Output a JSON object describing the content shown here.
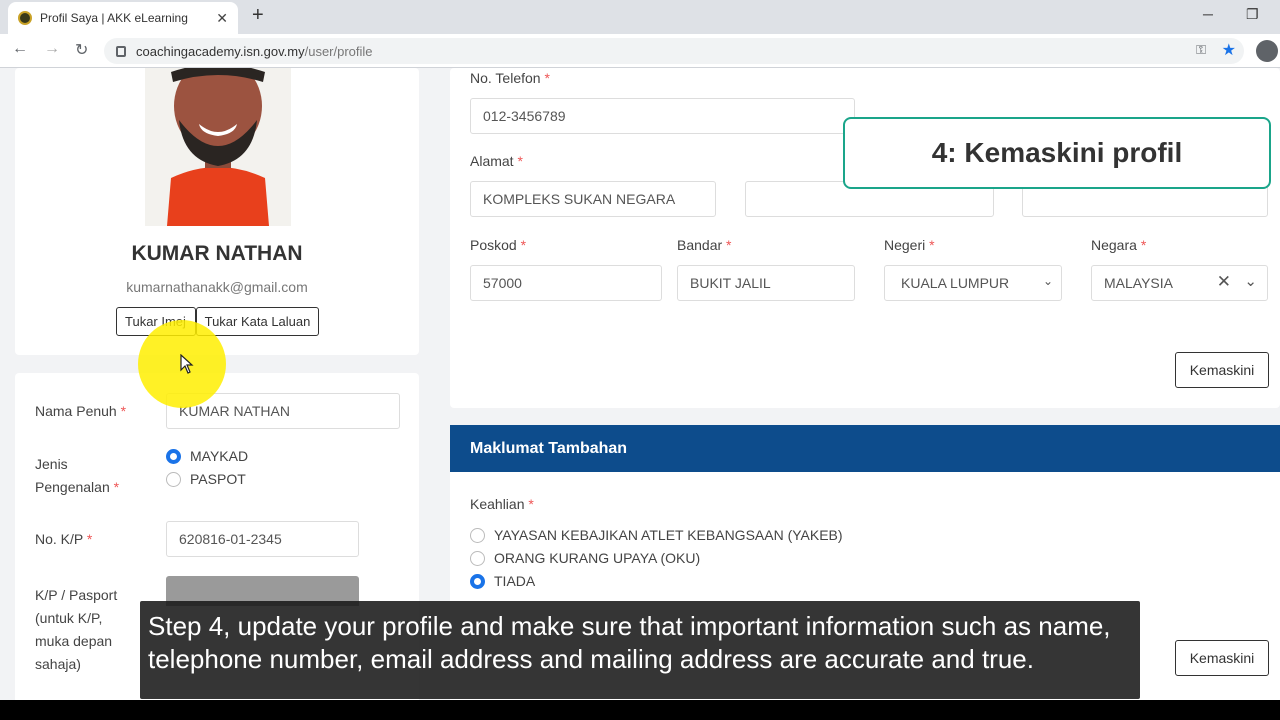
{
  "browser": {
    "tab_title": "Profil Saya | AKK eLearning",
    "tab_close": "✕",
    "new_tab": "+",
    "url_domain": "coachingacademy.isn.gov.my",
    "url_path": "/user/profile",
    "minimize": "─",
    "restore": "❐",
    "back": "←",
    "forward": "→",
    "reload": "↻",
    "key_icon": "⚿",
    "star_icon": "★"
  },
  "profile": {
    "name": "KUMAR NATHAN",
    "email": "kumarnathanakk@gmail.com",
    "change_image_btn": "Tukar Imej",
    "change_password_btn": "Tukar Kata Laluan"
  },
  "personal": {
    "full_name_label": "Nama Penuh",
    "full_name_value": "KUMAR NATHAN",
    "id_type_label_1": "Jenis",
    "id_type_label_2": "Pengenalan",
    "id_option_1": "MAYKAD",
    "id_option_2": "PASPOT",
    "ic_label": "No. K/P",
    "ic_value": "620816-01-2345",
    "passport_label_1": "K/P / Pasport",
    "passport_label_2": "(untuk K/P,",
    "passport_label_3": "muka depan",
    "passport_label_4": "sahaja)"
  },
  "contact": {
    "phone_label": "No. Telefon",
    "phone_value": "012-3456789",
    "address_label": "Alamat",
    "address_1": "KOMPLEKS SUKAN NEGARA",
    "postcode_label": "Poskod",
    "postcode_value": "57000",
    "city_label": "Bandar",
    "city_value": "BUKIT JALIL",
    "state_label": "Negeri",
    "state_value": "KUALA LUMPUR",
    "country_label": "Negara",
    "country_value": "MALAYSIA",
    "update_btn": "Kemaskini",
    "required_mark": "*"
  },
  "callout": {
    "text": "4: Kemaskini profil"
  },
  "extra": {
    "section_title": "Maklumat Tambahan",
    "skill_label": "Keahlian",
    "options": [
      "YAYASAN KEBAJIKAN ATLET KEBANGSAAN (YAKEB)",
      "ORANG KURANG UPAYA (OKU)",
      "TIADA"
    ],
    "update_btn": "Kemaskini"
  },
  "subtitle": {
    "text": "Step 4, update your profile and make sure that important information such as name, telephone number, email address and mailing address are accurate and true."
  }
}
